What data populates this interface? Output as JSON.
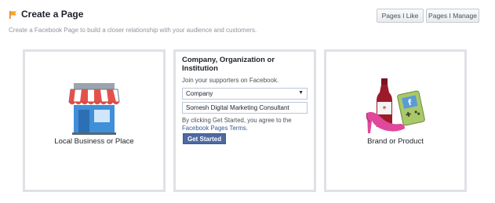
{
  "header": {
    "title": "Create a Page",
    "subtitle": "Create a Facebook Page to build a closer relationship with your audience and customers.",
    "pages_i_like": "Pages I Like",
    "pages_i_manage": "Pages I Manage"
  },
  "cards": {
    "local_business": {
      "label": "Local Business or Place",
      "icon": "storefront-icon"
    },
    "company": {
      "title": "Company, Organization or Institution",
      "subtitle": "Join your supporters on Facebook.",
      "category_selected": "Company",
      "name_value": "Somesh Digital Marketing Consultant",
      "terms_prefix": "By clicking Get Started, you agree to the",
      "terms_link": "Facebook Pages Terms",
      "terms_suffix": ".",
      "button": "Get Started"
    },
    "brand": {
      "label": "Brand or Product",
      "icon": "brand-products-icon"
    }
  },
  "colors": {
    "accent": "#4e69a2",
    "link": "#3b5998"
  }
}
